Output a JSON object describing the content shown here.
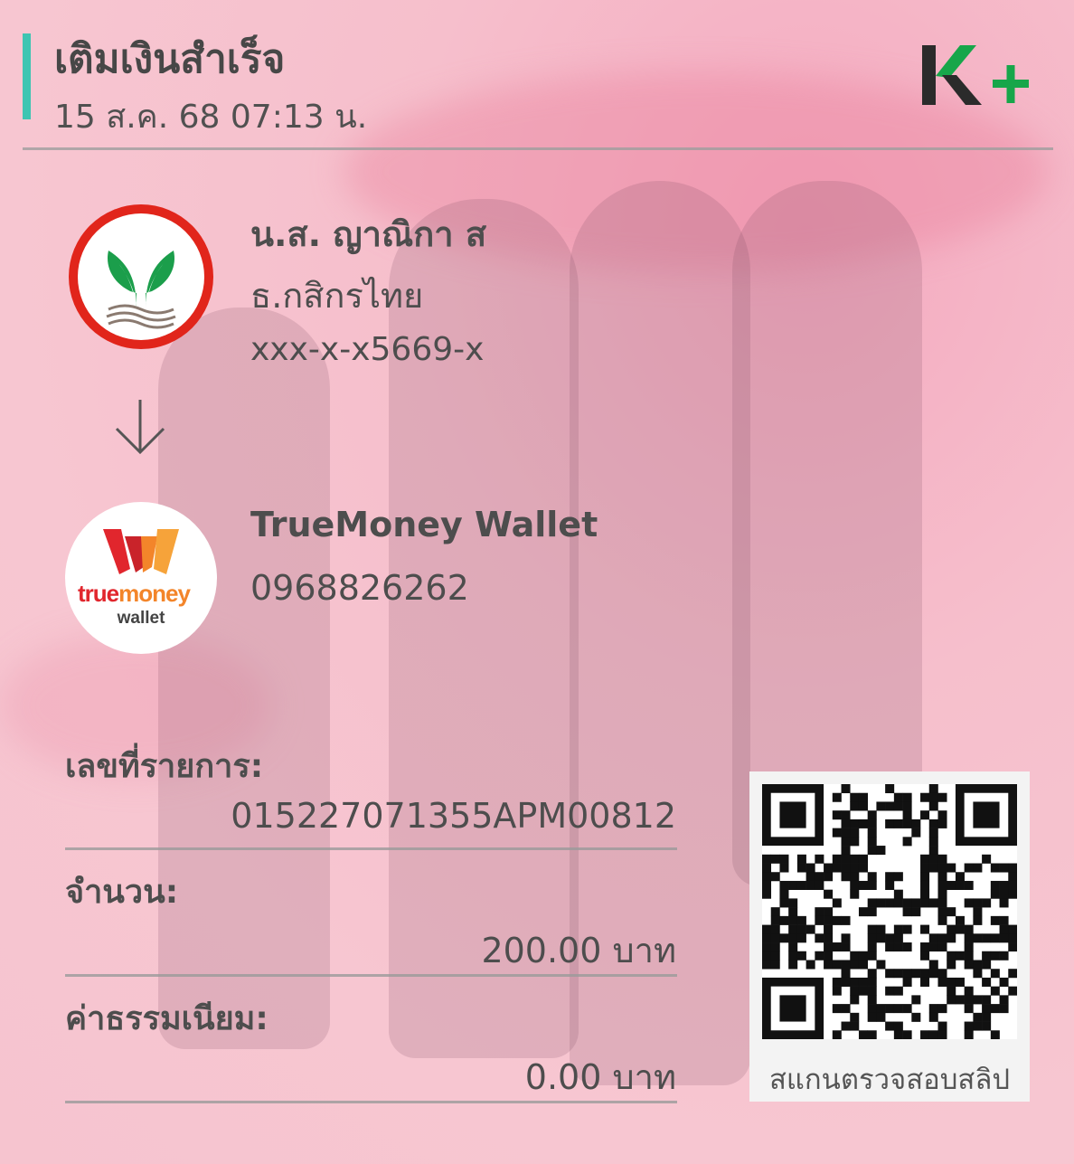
{
  "header": {
    "title": "เติมเงินสำเร็จ",
    "datetime": "15 ส.ค. 68  07:13 น.",
    "logo": "K+"
  },
  "sender": {
    "name": "น.ส. ญาณิกา ส",
    "bank": "ธ.กสิกรไทย",
    "account": "xxx-x-x5669-x",
    "logo_icon": "kasikornbank-logo-icon"
  },
  "receiver": {
    "name": "TrueMoney Wallet",
    "number": "0968826262",
    "logo_true": "true",
    "logo_money": "money",
    "logo_wallet": "wallet",
    "logo_icon": "truemoney-wallet-logo-icon"
  },
  "details": {
    "ref_label": "เลขที่รายการ:",
    "ref_value": "015227071355APM00812",
    "amount_label": "จำนวน:",
    "amount_value": "200.00 บาท",
    "fee_label": "ค่าธรรมเนียม:",
    "fee_value": "0.00 บาท"
  },
  "qr": {
    "caption": "สแกนตรวจสอบสลิป"
  },
  "colors": {
    "accent": "#3ec5b2",
    "kplus_dark": "#2b2b2b",
    "kplus_green": "#17a64a",
    "kbank_green": "#1b9e4b",
    "kbank_red": "#e1251b"
  }
}
